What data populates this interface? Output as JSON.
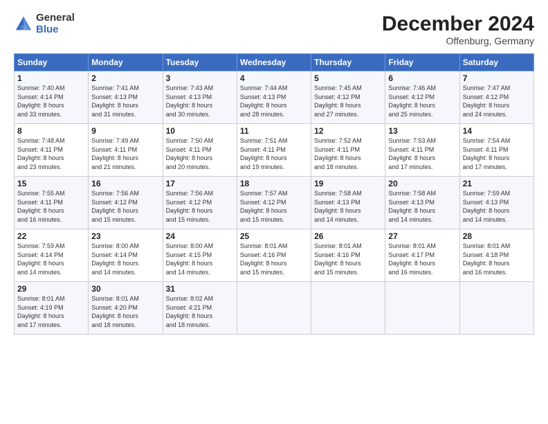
{
  "header": {
    "logo_text_top": "General",
    "logo_text_bottom": "Blue",
    "month_title": "December 2024",
    "location": "Offenburg, Germany"
  },
  "days_of_week": [
    "Sunday",
    "Monday",
    "Tuesday",
    "Wednesday",
    "Thursday",
    "Friday",
    "Saturday"
  ],
  "weeks": [
    [
      {
        "day": "1",
        "info": "Sunrise: 7:40 AM\nSunset: 4:14 PM\nDaylight: 8 hours\nand 33 minutes."
      },
      {
        "day": "2",
        "info": "Sunrise: 7:41 AM\nSunset: 4:13 PM\nDaylight: 8 hours\nand 31 minutes."
      },
      {
        "day": "3",
        "info": "Sunrise: 7:43 AM\nSunset: 4:13 PM\nDaylight: 8 hours\nand 30 minutes."
      },
      {
        "day": "4",
        "info": "Sunrise: 7:44 AM\nSunset: 4:13 PM\nDaylight: 8 hours\nand 28 minutes."
      },
      {
        "day": "5",
        "info": "Sunrise: 7:45 AM\nSunset: 4:12 PM\nDaylight: 8 hours\nand 27 minutes."
      },
      {
        "day": "6",
        "info": "Sunrise: 7:46 AM\nSunset: 4:12 PM\nDaylight: 8 hours\nand 25 minutes."
      },
      {
        "day": "7",
        "info": "Sunrise: 7:47 AM\nSunset: 4:12 PM\nDaylight: 8 hours\nand 24 minutes."
      }
    ],
    [
      {
        "day": "8",
        "info": "Sunrise: 7:48 AM\nSunset: 4:11 PM\nDaylight: 8 hours\nand 23 minutes."
      },
      {
        "day": "9",
        "info": "Sunrise: 7:49 AM\nSunset: 4:11 PM\nDaylight: 8 hours\nand 21 minutes."
      },
      {
        "day": "10",
        "info": "Sunrise: 7:50 AM\nSunset: 4:11 PM\nDaylight: 8 hours\nand 20 minutes."
      },
      {
        "day": "11",
        "info": "Sunrise: 7:51 AM\nSunset: 4:11 PM\nDaylight: 8 hours\nand 19 minutes."
      },
      {
        "day": "12",
        "info": "Sunrise: 7:52 AM\nSunset: 4:11 PM\nDaylight: 8 hours\nand 18 minutes."
      },
      {
        "day": "13",
        "info": "Sunrise: 7:53 AM\nSunset: 4:11 PM\nDaylight: 8 hours\nand 17 minutes."
      },
      {
        "day": "14",
        "info": "Sunrise: 7:54 AM\nSunset: 4:11 PM\nDaylight: 8 hours\nand 17 minutes."
      }
    ],
    [
      {
        "day": "15",
        "info": "Sunrise: 7:55 AM\nSunset: 4:11 PM\nDaylight: 8 hours\nand 16 minutes."
      },
      {
        "day": "16",
        "info": "Sunrise: 7:56 AM\nSunset: 4:12 PM\nDaylight: 8 hours\nand 15 minutes."
      },
      {
        "day": "17",
        "info": "Sunrise: 7:56 AM\nSunset: 4:12 PM\nDaylight: 8 hours\nand 15 minutes."
      },
      {
        "day": "18",
        "info": "Sunrise: 7:57 AM\nSunset: 4:12 PM\nDaylight: 8 hours\nand 15 minutes."
      },
      {
        "day": "19",
        "info": "Sunrise: 7:58 AM\nSunset: 4:13 PM\nDaylight: 8 hours\nand 14 minutes."
      },
      {
        "day": "20",
        "info": "Sunrise: 7:58 AM\nSunset: 4:13 PM\nDaylight: 8 hours\nand 14 minutes."
      },
      {
        "day": "21",
        "info": "Sunrise: 7:59 AM\nSunset: 4:13 PM\nDaylight: 8 hours\nand 14 minutes."
      }
    ],
    [
      {
        "day": "22",
        "info": "Sunrise: 7:59 AM\nSunset: 4:14 PM\nDaylight: 8 hours\nand 14 minutes."
      },
      {
        "day": "23",
        "info": "Sunrise: 8:00 AM\nSunset: 4:14 PM\nDaylight: 8 hours\nand 14 minutes."
      },
      {
        "day": "24",
        "info": "Sunrise: 8:00 AM\nSunset: 4:15 PM\nDaylight: 8 hours\nand 14 minutes."
      },
      {
        "day": "25",
        "info": "Sunrise: 8:01 AM\nSunset: 4:16 PM\nDaylight: 8 hours\nand 15 minutes."
      },
      {
        "day": "26",
        "info": "Sunrise: 8:01 AM\nSunset: 4:16 PM\nDaylight: 8 hours\nand 15 minutes."
      },
      {
        "day": "27",
        "info": "Sunrise: 8:01 AM\nSunset: 4:17 PM\nDaylight: 8 hours\nand 16 minutes."
      },
      {
        "day": "28",
        "info": "Sunrise: 8:01 AM\nSunset: 4:18 PM\nDaylight: 8 hours\nand 16 minutes."
      }
    ],
    [
      {
        "day": "29",
        "info": "Sunrise: 8:01 AM\nSunset: 4:19 PM\nDaylight: 8 hours\nand 17 minutes."
      },
      {
        "day": "30",
        "info": "Sunrise: 8:01 AM\nSunset: 4:20 PM\nDaylight: 8 hours\nand 18 minutes."
      },
      {
        "day": "31",
        "info": "Sunrise: 8:02 AM\nSunset: 4:21 PM\nDaylight: 8 hours\nand 18 minutes."
      },
      {
        "day": "",
        "info": ""
      },
      {
        "day": "",
        "info": ""
      },
      {
        "day": "",
        "info": ""
      },
      {
        "day": "",
        "info": ""
      }
    ]
  ]
}
